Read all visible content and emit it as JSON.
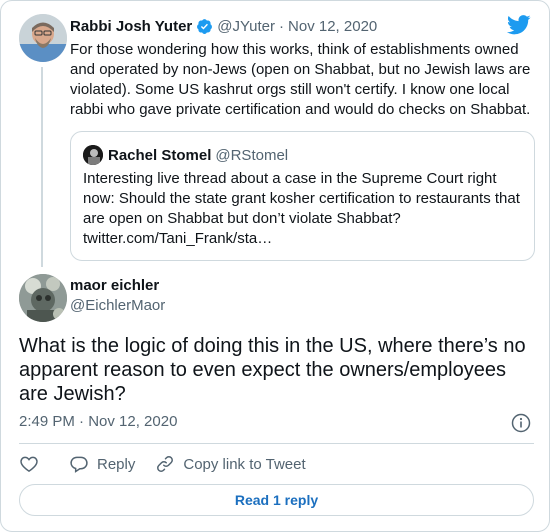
{
  "colors": {
    "accent": "#1d9bf0",
    "link": "#1b6fbf",
    "text": "#0f1419",
    "muted": "#536471",
    "border": "#cfd9de"
  },
  "parent_tweet": {
    "name": "Rabbi Josh Yuter",
    "handle": "@JYuter",
    "separator": "·",
    "date": "Nov 12, 2020",
    "text": "For those wondering how this works, think of establishments owned and operated by non-Jews (open on Shabbat, but no Jewish laws are violated). Some US kashrut orgs still won't certify. I know one local rabbi who gave private certification and would do checks on Shabbat.",
    "icons": {
      "verified": "verified-badge-icon",
      "brand": "twitter-bird-icon"
    }
  },
  "quoted_tweet": {
    "name": "Rachel Stomel",
    "handle": "@RStomel",
    "text": "Interesting live thread about a case in the Supreme Court right now: Should the state grant kosher certification to restaurants that are open on Shabbat but don’t violate Shabbat? twitter.com/Tani_Frank/sta…"
  },
  "main_tweet": {
    "name": "maor eichler",
    "handle": "@EichlerMaor",
    "text": "What is the logic of doing this in the US, where there’s no apparent reason to even expect the owners/employees are Jewish?",
    "timestamp": "2:49 PM · Nov 12, 2020",
    "icons": {
      "info": "info-icon"
    }
  },
  "actions": {
    "reply_label": "Reply",
    "copy_link_label": "Copy link to Tweet",
    "icons": [
      "heart-icon",
      "reply-icon",
      "link-icon"
    ]
  },
  "read_replies_label": "Read 1 reply"
}
